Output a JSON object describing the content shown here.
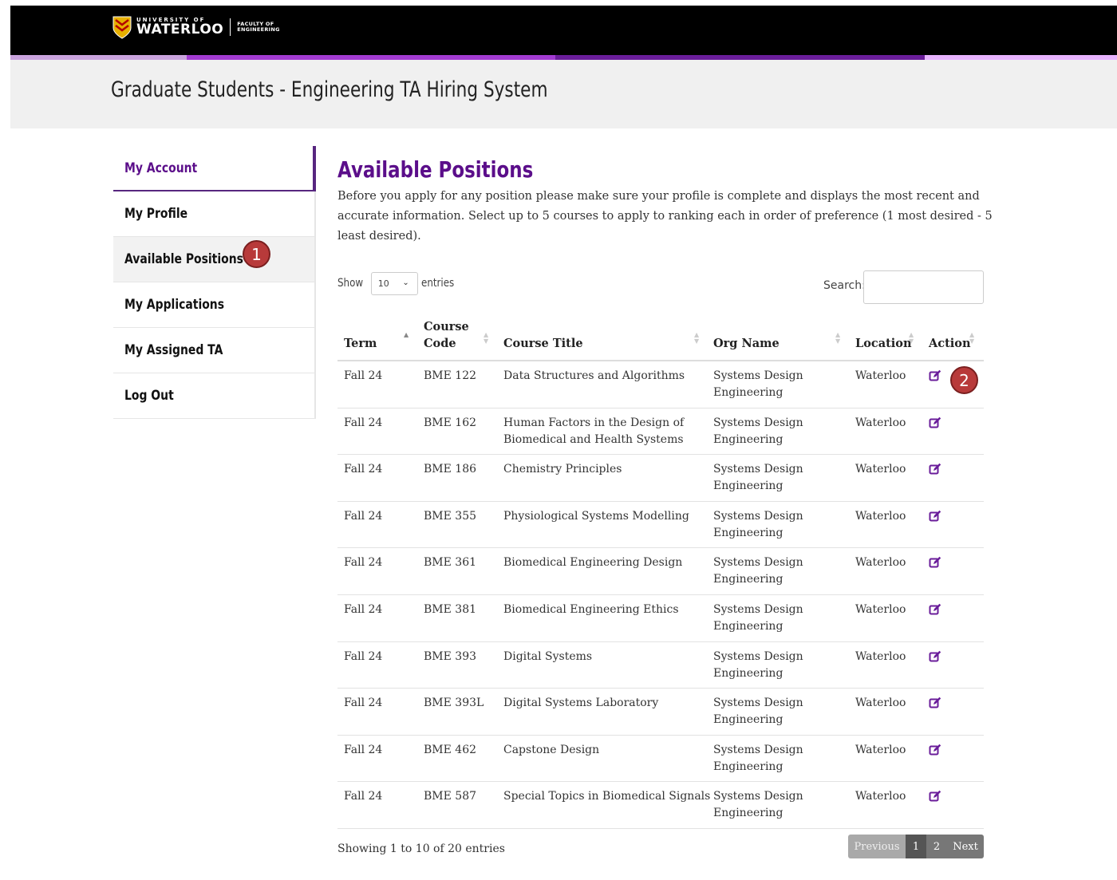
{
  "header": {
    "logo_small": "UNIVERSITY OF",
    "logo_big": "WATERLOO",
    "logo_faculty_1": "FACULTY OF",
    "logo_faculty_2": "ENGINEERING",
    "page_title": "Graduate Students - Engineering TA Hiring System"
  },
  "colors": {
    "header_bg": "#000000",
    "stripe": [
      "#c9a3dd",
      "#a23bd1",
      "#6a1d9a",
      "#e7b3ff"
    ],
    "accent": "#5b0e8a",
    "badge": "#b83a3a"
  },
  "sidebar": {
    "items": [
      {
        "label": "My Account"
      },
      {
        "label": "My Profile"
      },
      {
        "label": "Available Positions"
      },
      {
        "label": "My Applications"
      },
      {
        "label": "My Assigned TA"
      },
      {
        "label": "Log Out"
      }
    ]
  },
  "annotations": {
    "badge1": "1",
    "badge2": "2"
  },
  "main": {
    "title": "Available Positions",
    "intro": "Before you apply for any position please make sure your profile is complete and displays the most recent and accurate information. Select up to 5 courses to apply to ranking each in order of preference (1 most desired - 5 least desired).",
    "show_label": "Show",
    "show_value": "10",
    "entries_label": "entries",
    "search_label": "Search:",
    "search_value": ""
  },
  "table": {
    "headers": {
      "term": "Term",
      "code_1": "Course",
      "code_2": "Code",
      "title": "Course Title",
      "org": "Org Name",
      "location": "Location",
      "action": "Action"
    },
    "rows": [
      {
        "term": "Fall 24",
        "code": "BME 122",
        "title_1": "Data Structures and Algorithms",
        "title_2": "",
        "org_1": "Systems Design",
        "org_2": "Engineering",
        "location": "Waterloo"
      },
      {
        "term": "Fall 24",
        "code": "BME 162",
        "title_1": "Human Factors in the Design of",
        "title_2": "Biomedical and Health Systems",
        "org_1": "Systems Design",
        "org_2": "Engineering",
        "location": "Waterloo"
      },
      {
        "term": "Fall 24",
        "code": "BME 186",
        "title_1": "Chemistry Principles",
        "title_2": "",
        "org_1": "Systems Design",
        "org_2": "Engineering",
        "location": "Waterloo"
      },
      {
        "term": "Fall 24",
        "code": "BME 355",
        "title_1": "Physiological Systems Modelling",
        "title_2": "",
        "org_1": "Systems Design",
        "org_2": "Engineering",
        "location": "Waterloo"
      },
      {
        "term": "Fall 24",
        "code": "BME 361",
        "title_1": "Biomedical Engineering Design",
        "title_2": "",
        "org_1": "Systems Design",
        "org_2": "Engineering",
        "location": "Waterloo"
      },
      {
        "term": "Fall 24",
        "code": "BME 381",
        "title_1": "Biomedical Engineering Ethics",
        "title_2": "",
        "org_1": "Systems Design",
        "org_2": "Engineering",
        "location": "Waterloo"
      },
      {
        "term": "Fall 24",
        "code": "BME 393",
        "title_1": "Digital Systems",
        "title_2": "",
        "org_1": "Systems Design",
        "org_2": "Engineering",
        "location": "Waterloo"
      },
      {
        "term": "Fall 24",
        "code": "BME 393L",
        "title_1": "Digital Systems Laboratory",
        "title_2": "",
        "org_1": "Systems Design",
        "org_2": "Engineering",
        "location": "Waterloo"
      },
      {
        "term": "Fall 24",
        "code": "BME 462",
        "title_1": "Capstone Design",
        "title_2": "",
        "org_1": "Systems Design",
        "org_2": "Engineering",
        "location": "Waterloo"
      },
      {
        "term": "Fall 24",
        "code": "BME 587",
        "title_1": "Special Topics in Biomedical Signals",
        "title_2": "",
        "org_1": "Systems Design",
        "org_2": "Engineering",
        "location": "Waterloo"
      }
    ]
  },
  "footer": {
    "showing": "Showing 1 to 10 of 20 entries",
    "prev": "Previous",
    "page1": "1",
    "page2": "2",
    "next": "Next"
  }
}
